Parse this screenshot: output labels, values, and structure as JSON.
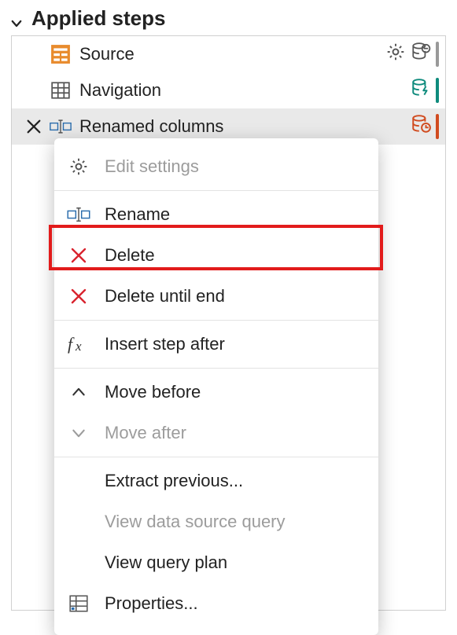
{
  "header": {
    "title": "Applied steps"
  },
  "steps": [
    {
      "label": "Source",
      "icon": "table-orange-icon",
      "selected": false,
      "actions": {
        "gear": true,
        "status": "db-minus-icon",
        "sideColor": "side-grey"
      }
    },
    {
      "label": "Navigation",
      "icon": "table-outline-icon",
      "selected": false,
      "actions": {
        "gear": false,
        "status": "db-flash-icon",
        "sideColor": "side-teal"
      }
    },
    {
      "label": "Renamed columns",
      "icon": "rename-icon",
      "selected": true,
      "gutter": "close-icon",
      "actions": {
        "gear": false,
        "status": "db-clock-icon",
        "sideColor": "side-orange"
      }
    }
  ],
  "contextMenu": {
    "groups": [
      [
        {
          "icon": "gear-icon",
          "label": "Edit settings",
          "disabled": true
        }
      ],
      [
        {
          "icon": "rename-icon",
          "label": "Rename",
          "disabled": false
        },
        {
          "icon": "x-red-icon",
          "label": "Delete",
          "disabled": false,
          "highlighted": true
        },
        {
          "icon": "x-red-icon",
          "label": "Delete until end",
          "disabled": false
        }
      ],
      [
        {
          "icon": "fx-icon",
          "label": "Insert step after",
          "disabled": false
        }
      ],
      [
        {
          "icon": "chevron-up-icon",
          "label": "Move before",
          "disabled": false
        },
        {
          "icon": "chevron-down-icon",
          "label": "Move after",
          "disabled": true
        }
      ],
      [
        {
          "icon": "",
          "label": "Extract previous...",
          "disabled": false
        },
        {
          "icon": "",
          "label": "View data source query",
          "disabled": true
        },
        {
          "icon": "",
          "label": "View query plan",
          "disabled": false
        },
        {
          "icon": "properties-icon",
          "label": "Properties...",
          "disabled": false
        }
      ]
    ]
  }
}
